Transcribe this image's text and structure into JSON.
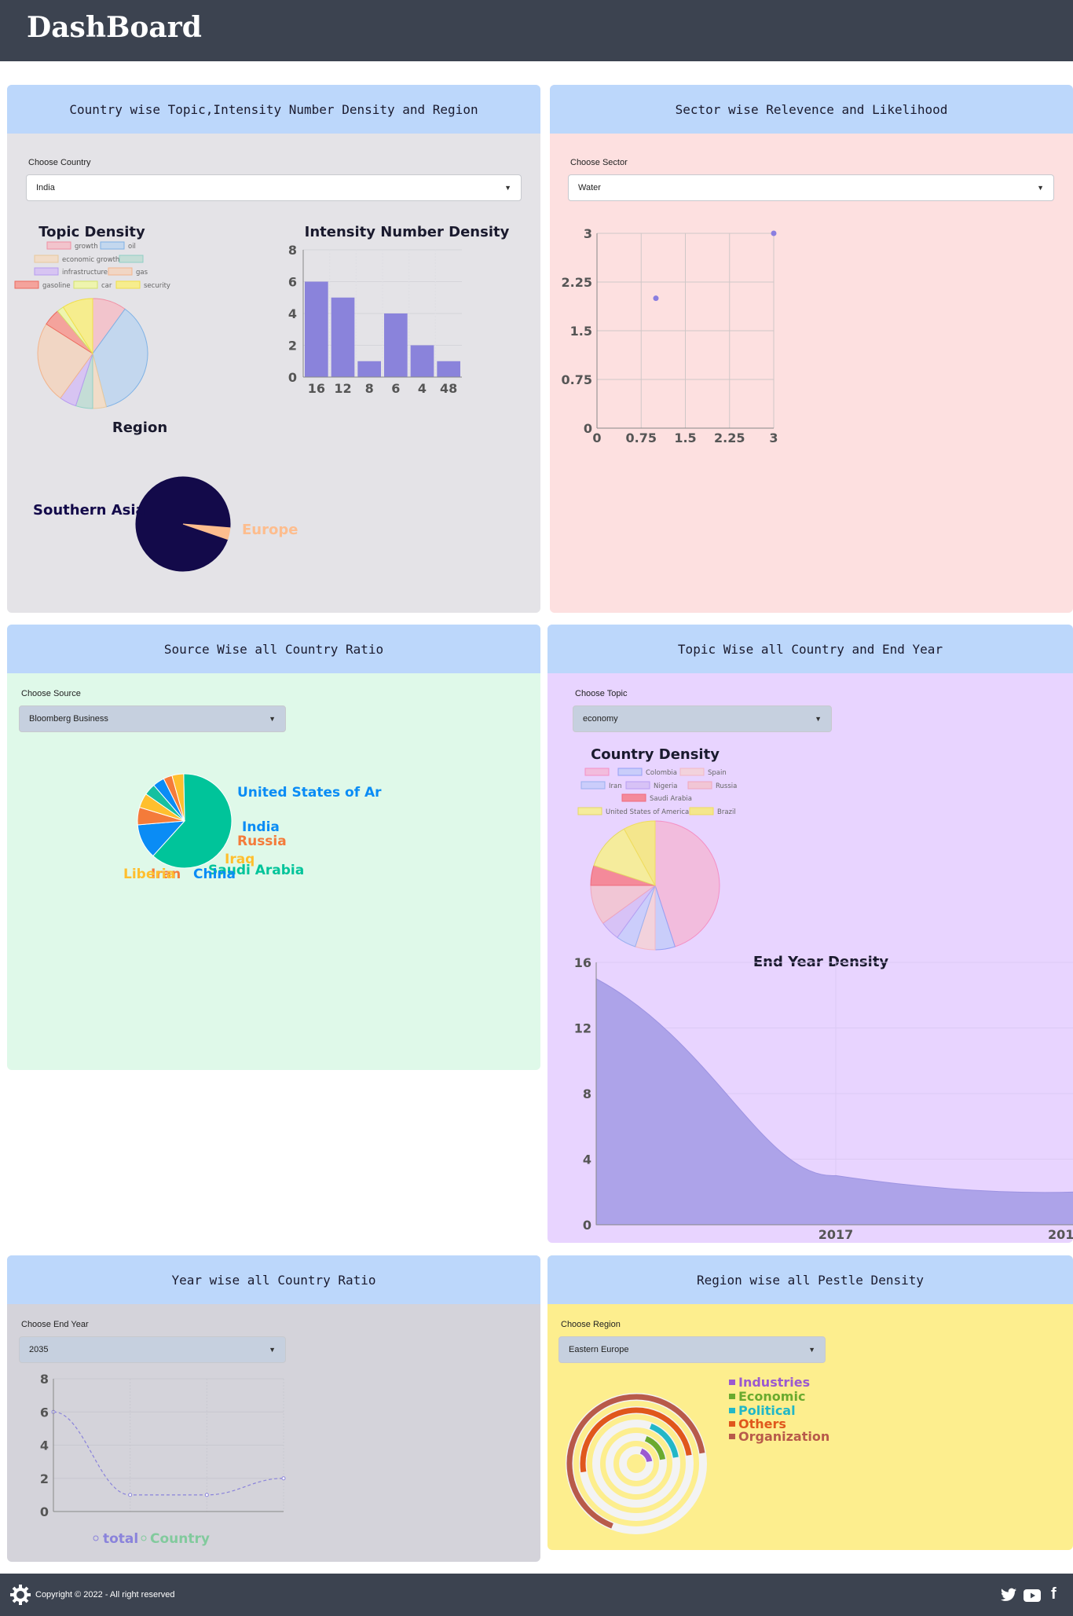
{
  "header": {
    "title": "DashBoard"
  },
  "panels": {
    "country": {
      "title": "Country wise Topic,Intensity Number Density and Region",
      "label": "Choose Country",
      "value": "India",
      "topic_title": "Topic Density",
      "topic_legend": [
        "growth",
        "oil",
        "economic growth",
        "",
        "infrastructure",
        "gas",
        "gasoline",
        "car",
        "security"
      ],
      "intensity_title": "Intensity Number Density",
      "region_title": "Region",
      "region_labels": [
        "Southern Asia",
        "Europe"
      ]
    },
    "sector": {
      "title": "Sector wise Relevence and Likelihood",
      "label": "Choose Sector",
      "value": "Water"
    },
    "source": {
      "title": "Source Wise all Country Ratio",
      "label": "Choose Source",
      "value": "Bloomberg Business",
      "pie_labels": [
        "United States of Ar",
        "India",
        "Russia",
        "Iraq",
        "Saudi Arabia",
        "China",
        "Iran",
        "Liberia"
      ]
    },
    "topic": {
      "title": "Topic Wise all Country and End Year",
      "label": "Choose Topic",
      "value": "economy",
      "country_title": "Country Density",
      "country_legend": [
        "",
        "Colombia",
        "Spain",
        "Iran",
        "Nigeria",
        "Russia",
        "Saudi Arabia",
        "United States of America",
        "Brazil"
      ],
      "end_year_title": "End Year Density"
    },
    "year": {
      "title": "Year wise all Country Ratio",
      "label": "Choose End Year",
      "value": "2035",
      "legend": [
        "total",
        "Country"
      ]
    },
    "region": {
      "title": "Region wise all Pestle Density",
      "label": "Choose Region",
      "value": "Eastern Europe",
      "legend": [
        "Industries",
        "Economic",
        "Political",
        "Others",
        "Organization"
      ]
    }
  },
  "footer": {
    "copyright": "Copyright © 2022 - All right reserved"
  },
  "colors": {
    "topbar": "#3c4350",
    "head": "#bcd7fb",
    "bar": "#8a83db"
  },
  "chart_data": [
    {
      "type": "pie",
      "title": "Topic Density",
      "categories": [
        "growth",
        "oil",
        "economic growth",
        "",
        "infrastructure",
        "gas",
        "gasoline",
        "car",
        "security"
      ],
      "values": [
        10,
        36,
        4,
        5,
        5,
        24,
        5,
        2,
        9
      ]
    },
    {
      "type": "bar",
      "title": "Intensity Number Density",
      "categories": [
        "16",
        "12",
        "8",
        "6",
        "4",
        "48"
      ],
      "values": [
        6,
        5,
        1,
        4,
        2,
        1
      ],
      "ylim": [
        0,
        8
      ],
      "yticks": [
        "0",
        "2",
        "4",
        "6",
        "8"
      ]
    },
    {
      "type": "pie",
      "title": "Region",
      "categories": [
        "Southern Asia",
        "Europe"
      ],
      "values": [
        96,
        4
      ]
    },
    {
      "type": "scatter",
      "x": [
        1,
        3
      ],
      "y": [
        2,
        3
      ],
      "xlim": [
        0,
        3
      ],
      "ylim": [
        0,
        3
      ],
      "xticks": [
        "0",
        "0.75",
        "1.5",
        "2.25",
        "3"
      ],
      "yticks": [
        "0",
        "0.75",
        "1.5",
        "2.25",
        "3"
      ]
    },
    {
      "type": "pie",
      "categories": [
        "United States of Ar",
        "India",
        "Russia",
        "Iraq",
        "Saudi Arabia",
        "China",
        "Iran",
        "Liberia"
      ],
      "values": [
        62,
        12,
        6,
        5,
        4,
        4,
        3,
        4
      ]
    },
    {
      "type": "pie",
      "title": "Country Density",
      "categories": [
        "",
        "Colombia",
        "Spain",
        "Iran",
        "Nigeria",
        "Russia",
        "Saudi Arabia",
        "United States of America",
        "Brazil"
      ],
      "values": [
        45,
        5,
        5,
        5,
        5,
        10,
        5,
        12,
        8
      ]
    },
    {
      "type": "area",
      "title": "End Year Density",
      "ylim": [
        0,
        16
      ],
      "yticks": [
        "0",
        "4",
        "8",
        "12",
        "16"
      ],
      "xticks": [
        "2017",
        "201"
      ],
      "values": [
        15,
        3,
        2
      ]
    },
    {
      "type": "line",
      "values": [
        6,
        1,
        1,
        2
      ],
      "ylim": [
        0,
        8
      ],
      "yticks": [
        "0",
        "2",
        "4",
        "6",
        "8"
      ]
    },
    {
      "type": "radial-bar",
      "categories": [
        "Industries",
        "Economic",
        "Political",
        "Others",
        "Organization"
      ],
      "values": [
        1,
        1,
        1,
        3,
        4
      ],
      "colors": [
        "#9b59d0",
        "#6aaa2e",
        "#22b7c7",
        "#e0571c",
        "#b85a4a"
      ]
    }
  ]
}
